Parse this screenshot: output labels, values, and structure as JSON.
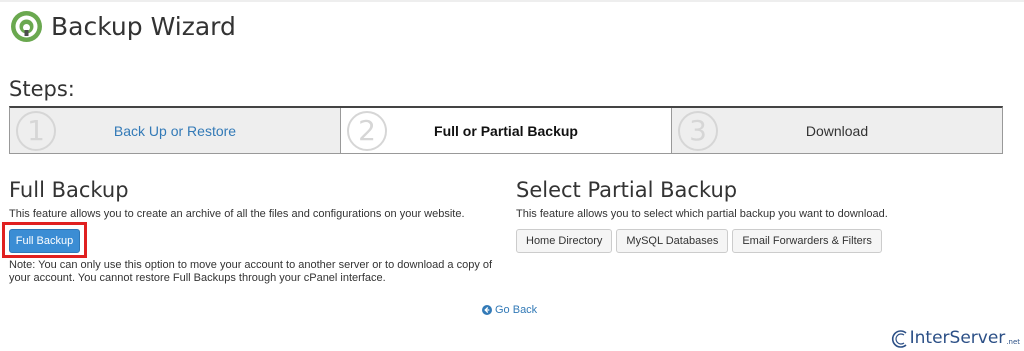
{
  "header": {
    "title": "Backup Wizard"
  },
  "steps": {
    "heading": "Steps:",
    "items": [
      {
        "number": "1",
        "label": "Back Up or Restore"
      },
      {
        "number": "2",
        "label": "Full or Partial Backup"
      },
      {
        "number": "3",
        "label": "Download"
      }
    ]
  },
  "full_backup": {
    "title": "Full Backup",
    "description": "This feature allows you to create an archive of all the files and configurations on your website.",
    "button_label": "Full Backup",
    "note": "Note: You can only use this option to move your account to another server or to download a copy of your account. You cannot restore Full Backups through your cPanel interface."
  },
  "partial_backup": {
    "title": "Select Partial Backup",
    "description": "This feature allows you to select which partial backup you want to download.",
    "buttons": [
      "Home Directory",
      "MySQL Databases",
      "Email Forwarders & Filters"
    ]
  },
  "go_back": {
    "label": "Go Back"
  },
  "brand": {
    "name": "InterServer",
    "suffix": ".net"
  },
  "colors": {
    "primary": "#3b8dd4",
    "link": "#337ab7",
    "highlight": "#e02020",
    "logo": "#6aa84f"
  },
  "icons": {
    "logo": "backup-wizard-icon",
    "go_back": "circle-arrow-left-icon"
  }
}
